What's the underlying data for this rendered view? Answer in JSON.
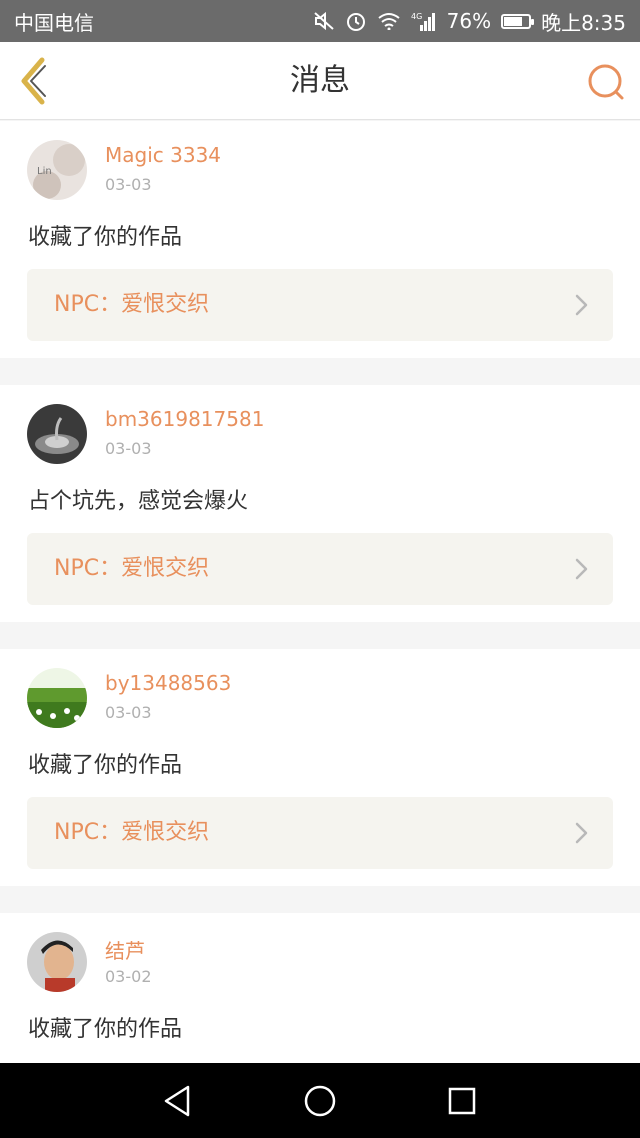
{
  "status_bar": {
    "carrier": "中国电信",
    "network": "4G",
    "battery_percent": "76%",
    "battery_level": 0.76,
    "time": "晚上8:35"
  },
  "header": {
    "title": "消息",
    "back_icon": "chevron-left-icon",
    "search_icon": "search-icon"
  },
  "colors": {
    "accent": "#e8905d",
    "back_icon": "#d9b34a",
    "card_link_bg": "#f5f4ef"
  },
  "messages": [
    {
      "username": "Magic 3334",
      "date": "03-03",
      "action": "收藏了你的作品",
      "work": "NPC：爱恨交织"
    },
    {
      "username": "bm3619817581",
      "date": "03-03",
      "action": "占个坑先，感觉会爆火",
      "work": "NPC：爱恨交织"
    },
    {
      "username": "by13488563",
      "date": "03-03",
      "action": "收藏了你的作品",
      "work": "NPC：爱恨交织"
    },
    {
      "username": "结芦",
      "date": "03-02",
      "action": "收藏了你的作品"
    }
  ],
  "system_nav": {
    "back": "triangle-back-icon",
    "home": "circle-home-icon",
    "recents": "square-recents-icon"
  }
}
